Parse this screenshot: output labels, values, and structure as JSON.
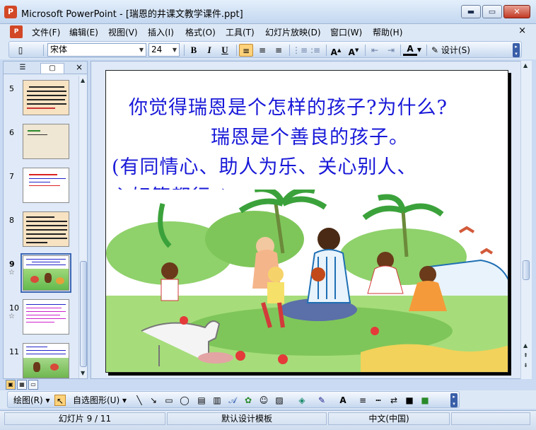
{
  "window": {
    "icon_label": "P",
    "title": "Microsoft PowerPoint - [瑞恩的井课文教学课件.ppt]",
    "minimize": "▬",
    "maximize": "▭",
    "close": "✕"
  },
  "menu": {
    "items": [
      "文件(F)",
      "编辑(E)",
      "视图(V)",
      "插入(I)",
      "格式(O)",
      "工具(T)",
      "幻灯片放映(D)",
      "窗口(W)",
      "帮助(H)"
    ],
    "close": "×"
  },
  "toolbar": {
    "font_name": "宋体",
    "font_size": "24",
    "bold": "B",
    "italic": "I",
    "underline": "U",
    "design_label": "设计(S)"
  },
  "left_pane": {
    "close": "×",
    "thumbnails": [
      {
        "number": "5",
        "star": ""
      },
      {
        "number": "6",
        "star": ""
      },
      {
        "number": "7",
        "star": ""
      },
      {
        "number": "8",
        "star": ""
      },
      {
        "number": "9",
        "star": "☆"
      },
      {
        "number": "10",
        "star": "☆"
      },
      {
        "number": "11",
        "star": ""
      }
    ]
  },
  "slide": {
    "line1": "你觉得瑞恩是个怎样的孩子?为什么?",
    "line2": "瑞恩是个善良的孩子。",
    "line3": "(有同情心、助人为乐、关心别人、",
    "line4": "心好等都行。)"
  },
  "draw_toolbar": {
    "draw_label": "绘图(R)",
    "autoshapes_label": "自选图形(U)"
  },
  "status": {
    "slide_counter": "幻灯片 9 / 11",
    "template": "默认设计模板",
    "language": "中文(中国)"
  },
  "colors": {
    "slide_text": "#1818d8",
    "accent": "#d24726",
    "selection": "#fdd27a"
  }
}
